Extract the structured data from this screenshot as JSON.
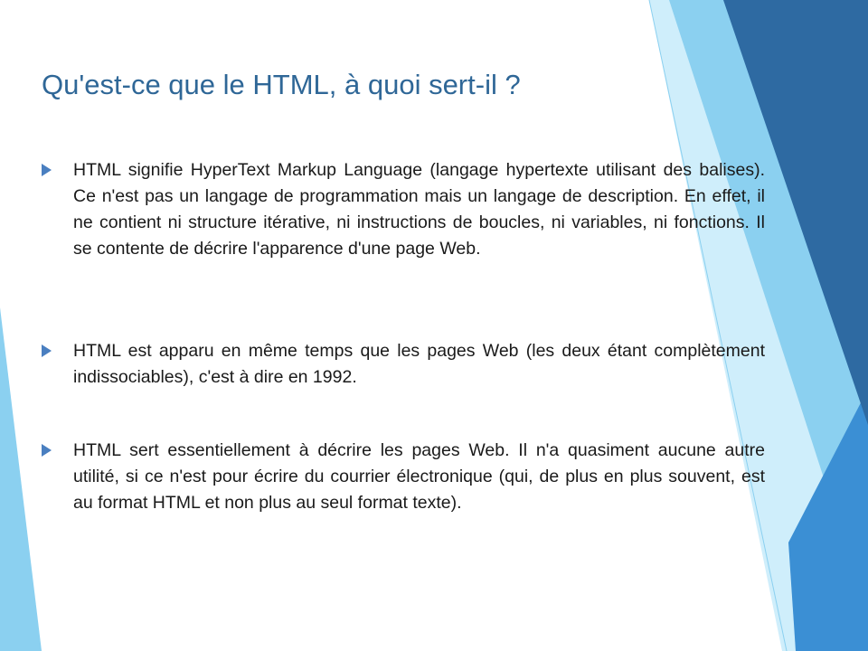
{
  "slide": {
    "title": "Qu'est-ce que le HTML, à quoi sert-il ?",
    "bullets": [
      {
        "text": "HTML signifie HyperText Markup Language (langage hypertexte utilisant des balises). Ce n'est pas un langage de programmation mais un langage de description. En effet, il ne contient ni structure itérative, ni instructions de boucles, ni variables, ni fonctions. Il se contente de décrire l'apparence d'une page Web."
      },
      {
        "text": "HTML est apparu en même temps que les pages Web (les deux étant complètement indissociables), c'est à dire en 1992."
      },
      {
        "text": "HTML sert essentiellement à décrire les pages Web. Il n'a quasiment aucune autre utilité, si ce n'est pour écrire du courrier électronique (qui, de plus en plus souvent, est au format HTML et non plus au seul format texte)."
      }
    ]
  },
  "theme": {
    "title_color": "#2f6797",
    "bullet_color": "#4a7fc0",
    "text_color": "#1a1a1a",
    "deco_colors": [
      "#8bd0f0",
      "#cfeefb",
      "#3b8fd4",
      "#2e6aa2"
    ]
  }
}
